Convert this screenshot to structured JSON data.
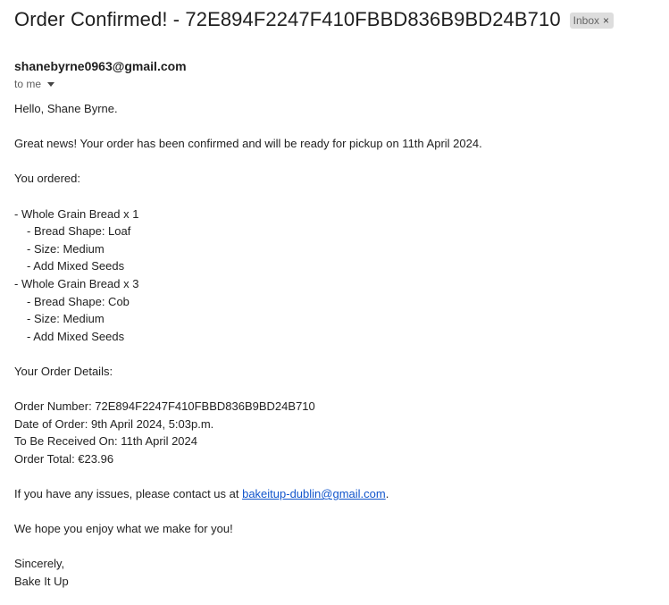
{
  "header": {
    "subject": "Order Confirmed! - 72E894F2247F410FBBD836B9BD24B710",
    "label": "Inbox",
    "label_close_icon": "close-icon",
    "sender": "shanebyrne0963@gmail.com",
    "recipient": "to me",
    "recipient_icon": "chevron-down-icon"
  },
  "body": {
    "greeting": "Hello, Shane Byrne.",
    "intro": "Great news! Your order has been confirmed and will be ready for pickup on 11th April 2024.",
    "ordered_heading": "You ordered:",
    "items": [
      {
        "title": "- Whole Grain Bread x 1",
        "options": [
          "- Bread Shape: Loaf",
          "- Size: Medium",
          "- Add Mixed Seeds"
        ]
      },
      {
        "title": "- Whole Grain Bread x 3",
        "options": [
          "- Bread Shape: Cob",
          "- Size: Medium",
          "- Add Mixed Seeds"
        ]
      }
    ],
    "details_heading": "Your Order Details:",
    "order_number": "Order Number: 72E894F2247F410FBBD836B9BD24B710",
    "order_date": "Date of Order: 9th April 2024, 5:03p.m.",
    "receive_date": "To Be Received On: 11th April 2024",
    "order_total": "Order Total: €23.96",
    "issues_prefix": "If you have any issues, please contact us at ",
    "contact_email": "bakeitup-dublin@gmail.com",
    "issues_suffix": ".",
    "closing": "We hope you enjoy what we make for you!",
    "signoff": "Sincerely,",
    "signature": "Bake It Up"
  },
  "colors": {
    "link": "#1155cc",
    "chip_bg": "#dddddd",
    "text": "#222222"
  }
}
